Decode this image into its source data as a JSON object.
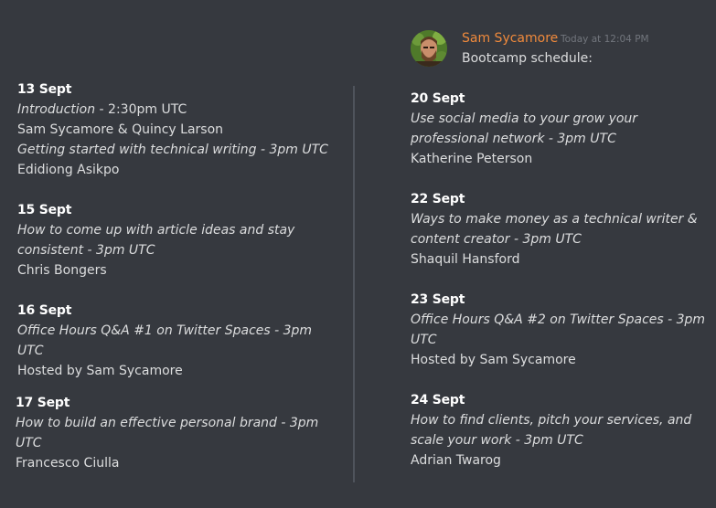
{
  "message": {
    "author": "Sam Sycamore",
    "timestamp": "Today at 12:04 PM",
    "intro": "Bootcamp schedule:"
  },
  "left_column": [
    {
      "date": "13 Sept",
      "title": "Introduction",
      "time": " - 2:30pm UTC",
      "host": "Sam Sycamore & Quincy Larson"
    },
    {
      "date": "",
      "title": "Getting started with technical writing - 3pm UTC",
      "time": "",
      "host": "Edidiong Asikpo"
    },
    {
      "date": "15 Sept",
      "title": "How to come up with article ideas and stay consistent - 3pm UTC",
      "time": "",
      "host": "Chris Bongers"
    },
    {
      "date": "16 Sept",
      "title": "Office Hours Q&A #1 on Twitter Spaces - 3pm UTC",
      "time": "",
      "host": "Hosted by Sam Sycamore"
    },
    {
      "date": "17 Sept",
      "title": "How to build an effective personal brand - 3pm UTC",
      "time": "",
      "host": "Francesco Ciulla"
    }
  ],
  "right_column": [
    {
      "date": "20 Sept",
      "title": "Use social media to your grow your professional network - 3pm UTC",
      "host": "Katherine Peterson"
    },
    {
      "date": "22 Sept",
      "title": "Ways to make money as a technical writer & content creator - 3pm UTC",
      "host": "Shaquil Hansford"
    },
    {
      "date": "23 Sept",
      "title": "Office Hours Q&A #2 on Twitter Spaces - 3pm UTC",
      "host": "Hosted by Sam Sycamore"
    },
    {
      "date": "24 Sept",
      "title": "How to find clients, pitch your services, and scale your work - 3pm UTC",
      "host": "Adrian Twarog"
    }
  ],
  "icons": {
    "avatar": "user-avatar-icon"
  },
  "colors": {
    "background": "#36393f",
    "author": "#f08a3c",
    "text": "#dcddde",
    "timestamp": "#72767d",
    "divider": "#4f545c"
  }
}
